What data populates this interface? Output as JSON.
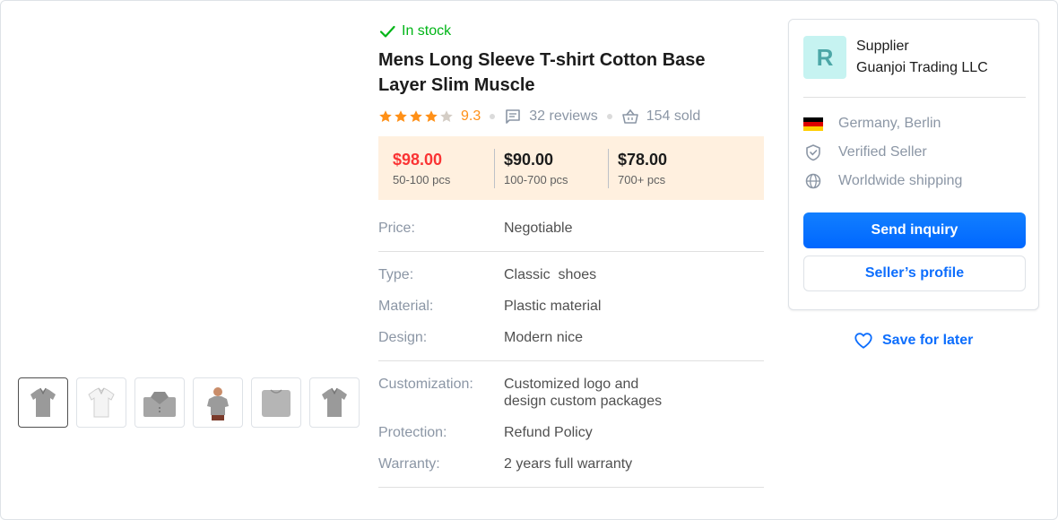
{
  "product": {
    "stock_status": "In stock",
    "title": "Mens Long Sleeve T-shirt Cotton Base Layer Slim Muscle",
    "rating": "9.3",
    "stars": 4,
    "reviews": "32 reviews",
    "sold": "154 sold"
  },
  "price_tiers": [
    {
      "price": "$98.00",
      "qty": "50-100 pcs"
    },
    {
      "price": "$90.00",
      "qty": "100-700 pcs"
    },
    {
      "price": "$78.00",
      "qty": "700+ pcs"
    }
  ],
  "specs": {
    "price": {
      "label": "Price:",
      "value": "Negotiable"
    },
    "type": {
      "label": "Type:",
      "value": "Classic  shoes"
    },
    "material": {
      "label": "Material:",
      "value": "Plastic material"
    },
    "design": {
      "label": "Design:",
      "value": "Modern nice"
    },
    "customization": {
      "label": "Customization:",
      "value_line1": "Customized logo and",
      "value_line2": "design custom packages"
    },
    "protection": {
      "label": "Protection:",
      "value": "Refund Policy"
    },
    "warranty": {
      "label": "Warranty:",
      "value": "2 years full warranty"
    }
  },
  "supplier": {
    "avatar_letter": "R",
    "label": "Supplier",
    "name": "Guanjoi Trading LLC",
    "location": "Germany, Berlin",
    "verified": "Verified Seller",
    "shipping": "Worldwide shipping",
    "send_inquiry": "Send inquiry",
    "seller_profile": "Seller’s profile"
  },
  "save_for_later": "Save for later",
  "thumbnails": [
    "gray-polo",
    "white-polo",
    "folded-gray-polo",
    "man-in-gray-tshirt",
    "folded-gray-tshirt",
    "gray-polo"
  ],
  "colors": {
    "accent": "#0d6efd",
    "stock": "#00b517",
    "rating": "#ff9017",
    "price_highlight": "#fa3434",
    "price_bg": "#fff0df"
  }
}
